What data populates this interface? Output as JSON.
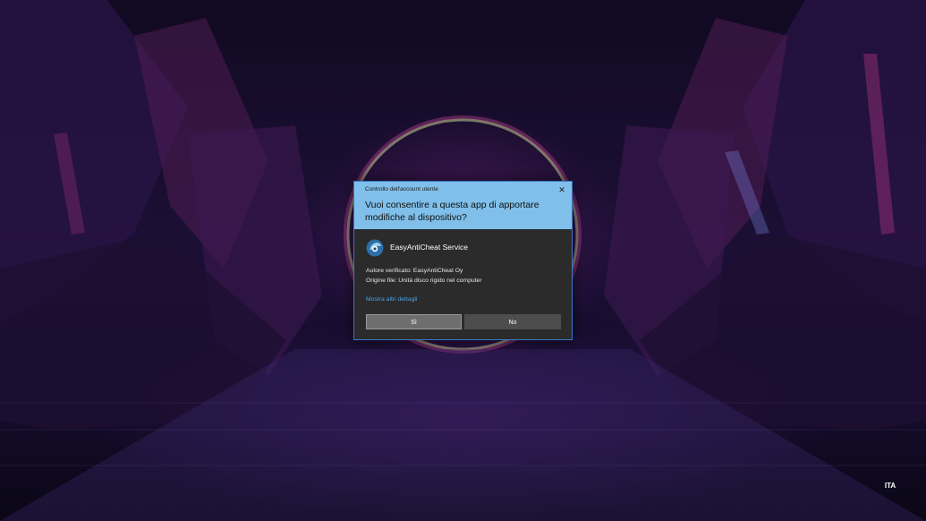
{
  "dialog": {
    "caption": "Controllo dell'account utente",
    "question": "Vuoi consentire a questa app di apportare modifiche al dispositivo?",
    "app_name": "EasyAntiCheat Service",
    "verified_publisher": "Autore verificato: EasyAntiCheat Oy",
    "file_origin": "Origine file: Unità disco rigido nel computer",
    "details_link": "Mostra altri dettagli",
    "yes_label": "Sì",
    "no_label": "No",
    "close_icon": "close-icon",
    "app_icon": "easyanticheat-icon"
  },
  "taskbar": {
    "language": "ITA"
  },
  "colors": {
    "header": "#7fbfea",
    "body": "#2b2b2b",
    "border": "#3a78c9",
    "link": "#4aa3e6",
    "yes_button": "#6e6e6e",
    "no_button": "#4d4d4d"
  }
}
